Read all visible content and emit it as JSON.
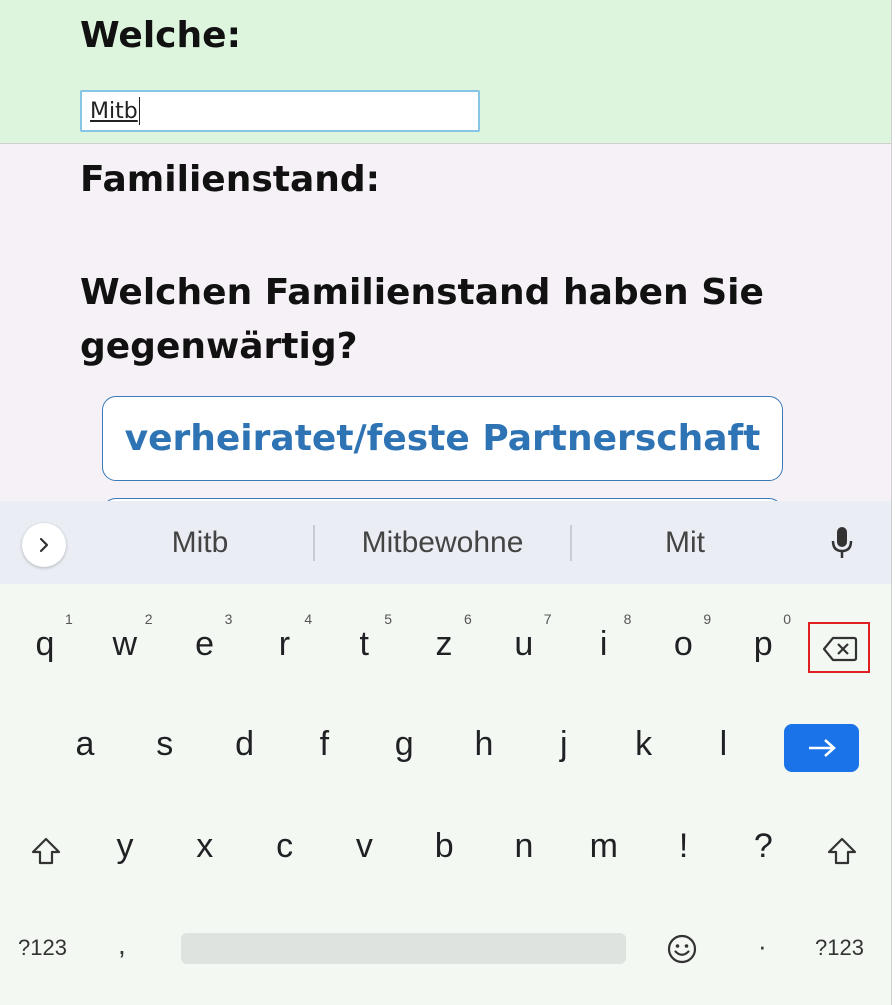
{
  "form": {
    "which_label": "Welche:",
    "which_value": "Mitb",
    "marital_heading": "Familienstand:",
    "question_line1": "Welchen Familienstand haben Sie",
    "question_line2": "gegenwärtig?",
    "options": [
      "verheiratet/feste Partnerschaft"
    ]
  },
  "keyboard": {
    "suggestions": [
      "Mitb",
      "Mitbewohne",
      "Mit"
    ],
    "row1": [
      "q",
      "w",
      "e",
      "r",
      "t",
      "z",
      "u",
      "i",
      "o",
      "p"
    ],
    "row1_hints": [
      "1",
      "2",
      "3",
      "4",
      "5",
      "6",
      "7",
      "8",
      "9",
      "0"
    ],
    "row2": [
      "a",
      "s",
      "d",
      "f",
      "g",
      "h",
      "j",
      "k",
      "l"
    ],
    "row3": [
      "y",
      "x",
      "c",
      "v",
      "b",
      "n",
      "m",
      "!",
      "?"
    ],
    "symbols_label": "?123",
    "comma": ",",
    "period": "·",
    "icons": {
      "expand": "chevron-right-icon",
      "mic": "microphone-icon",
      "backspace": "backspace-icon",
      "enter": "arrow-right-icon",
      "shift": "shift-icon",
      "emoji": "emoji-icon"
    },
    "colors": {
      "enter": "#1a73e8",
      "highlight": "#e02020"
    }
  }
}
